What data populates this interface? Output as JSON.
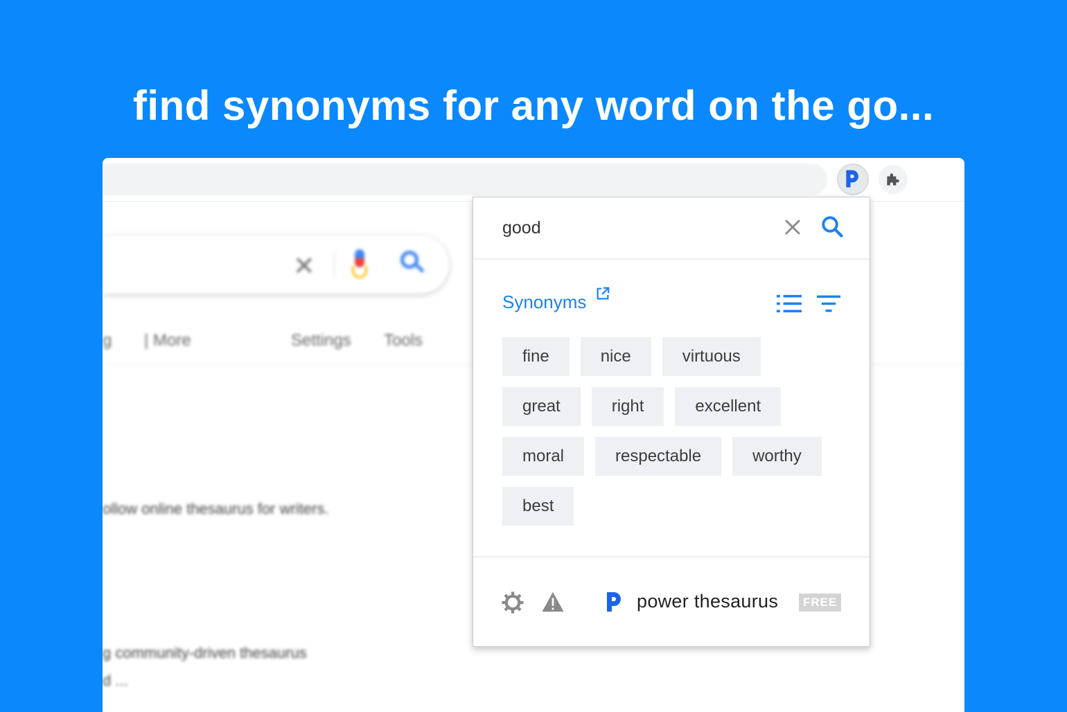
{
  "headline": "find synonyms for any word on the go...",
  "background_page": {
    "nav": {
      "partial_left": "g",
      "more": "| More",
      "settings": "Settings",
      "tools": "Tools"
    },
    "results": [
      "ollow online thesaurus for writers.",
      "g community-driven thesaurus",
      "d ..."
    ],
    "clear_glyph": "✕"
  },
  "popup": {
    "search_value": "good",
    "section_label": "Synonyms",
    "synonym_rows": [
      [
        "fine",
        "nice",
        "virtuous"
      ],
      [
        "great",
        "right",
        "excellent"
      ],
      [
        "moral",
        "respectable",
        "worthy"
      ],
      [
        "best"
      ]
    ],
    "brand_name": "power thesaurus",
    "badge": "FREE"
  },
  "icons": {
    "toolbar": [
      "power-thesaurus-extension-icon",
      "puzzle-extensions-icon"
    ],
    "popup": [
      "clear-icon",
      "search-icon",
      "external-link-icon",
      "list-view-icon",
      "filter-icon",
      "gear-icon",
      "warning-icon",
      "power-thesaurus-logo-icon"
    ]
  },
  "colors": {
    "background": "#0a88fc",
    "accent": "#1a82f0",
    "brand": "#1d63e8",
    "chip_bg": "#eef0f3",
    "badge_bg": "#d4d4d4"
  }
}
